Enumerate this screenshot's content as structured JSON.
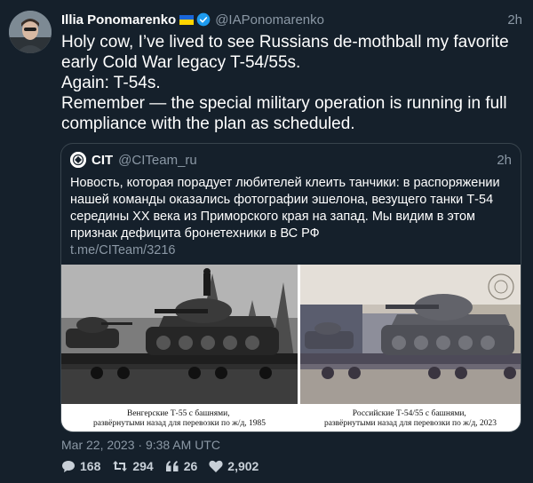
{
  "author": {
    "name": "Illia Ponomarenko",
    "handle": "@IAPonomarenko",
    "time": "2h"
  },
  "tweet": {
    "text": "Holy cow, I’ve lived to see Russians de-mothball my favorite early Cold War legacy T-54/55s.\nAgain: T-54s.\nRemember — the special military operation is running in full compliance with the plan as scheduled."
  },
  "quote": {
    "name": "CIT",
    "handle": "@CITeam_ru",
    "time": "2h",
    "text": "Новость, которая порадует любителей клеить танчики: в распоряжении нашей команды оказались фотографии эшелона, везущего танки Т-54 середины XX века из Приморского края на запад. Мы видим в этом признак дефицита бронетехники в ВС РФ",
    "link": "t.me/CITeam/3216",
    "captions": {
      "left": "Венгерские Т-55 с башнями,\nразвёрнутыми назад для перевозки по ж/д, 1985",
      "right": "Российские Т-54/55 с башнями,\nразвёрнутыми назад для перевозки по ж/д, 2023"
    }
  },
  "meta": {
    "date": "Mar 22, 2023 · 9:38 AM UTC"
  },
  "stats": {
    "replies": "168",
    "retweets": "294",
    "quotes": "26",
    "likes": "2,902"
  },
  "colors": {
    "background": "#15202b",
    "secondary_text": "#8b98a5",
    "border": "#38444d",
    "verified": "#1d9bf0"
  }
}
